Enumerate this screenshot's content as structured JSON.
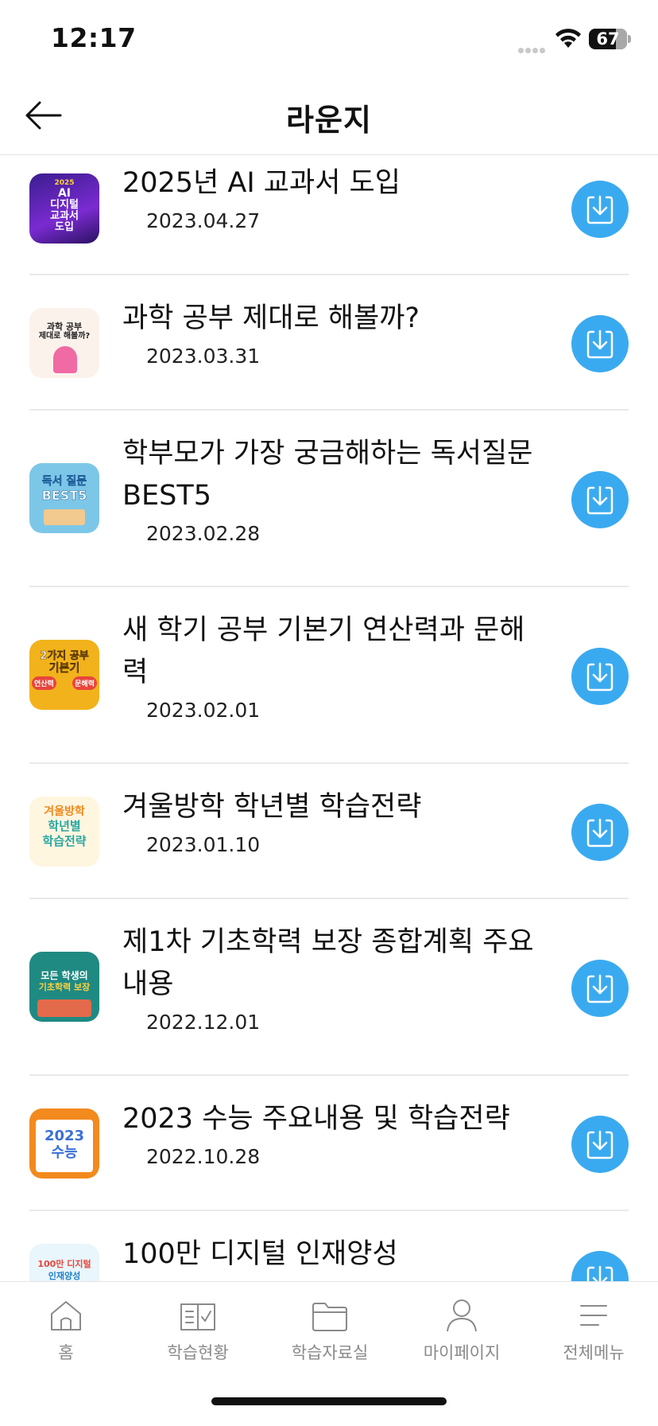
{
  "status_bar": {
    "time": "12:17",
    "battery": "67"
  },
  "header": {
    "title": "라운지"
  },
  "items": [
    {
      "title": "2025년 AI 교과서 도입",
      "date": "2023.04.27",
      "thumb_lines": [
        "2025",
        "AI",
        "디지털",
        "교과서",
        "도입"
      ]
    },
    {
      "title": "과학 공부 제대로 해볼까?",
      "date": "2023.03.31",
      "thumb_lines": [
        "과학 공부",
        "제대로 해볼까?"
      ]
    },
    {
      "title": "학부모가 가장 궁금해하는 독서질문 BEST5",
      "date": "2023.02.28",
      "thumb_lines": [
        "독서 질문",
        "BEST5"
      ]
    },
    {
      "title": "새 학기 공부 기본기 연산력과 문해력",
      "date": "2023.02.01",
      "thumb_lines": [
        "2가지 공부",
        "기본기",
        "연산력",
        "문해력"
      ]
    },
    {
      "title": "겨울방학 학년별 학습전략",
      "date": "2023.01.10",
      "thumb_lines": [
        "겨울방학",
        "학년별",
        "학습전략"
      ]
    },
    {
      "title": "제1차 기초학력 보장 종합계획 주요내용",
      "date": "2022.12.01",
      "thumb_lines": [
        "모든 학생의",
        "기초학력 보장"
      ]
    },
    {
      "title": "2023 수능 주요내용 및 학습전략",
      "date": "2022.10.28",
      "thumb_lines": [
        "2023",
        "수능"
      ]
    },
    {
      "title": "100만 디지털 인재양성",
      "date": "",
      "thumb_lines": [
        "100만 디지털",
        "인재양성"
      ]
    }
  ],
  "tabs": [
    {
      "label": "홈",
      "icon": "home-icon"
    },
    {
      "label": "학습현황",
      "icon": "study-status-icon"
    },
    {
      "label": "학습자료실",
      "icon": "folder-icon"
    },
    {
      "label": "마이페이지",
      "icon": "person-icon"
    },
    {
      "label": "전체메뉴",
      "icon": "menu-icon"
    }
  ],
  "colors": {
    "accent": "#3aaaf0",
    "tab_label": "#8a8a8a",
    "divider": "#e9e9e9"
  }
}
